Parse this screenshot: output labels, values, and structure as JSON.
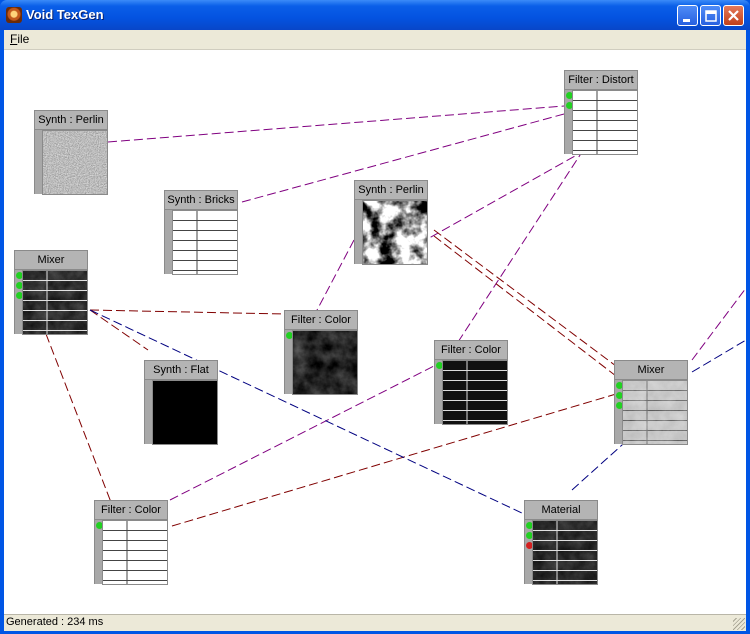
{
  "window": {
    "title": "Void TexGen"
  },
  "menu": {
    "file_label": "File"
  },
  "status": {
    "text": "Generated : 234 ms"
  },
  "nodes": {
    "synth_perlin_1": {
      "title": "Synth : Perlin"
    },
    "synth_bricks": {
      "title": "Synth : Bricks"
    },
    "synth_perlin_2": {
      "title": "Synth : Perlin"
    },
    "filter_distort": {
      "title": "Filter : Distort"
    },
    "mixer_1": {
      "title": "Mixer"
    },
    "filter_color_1": {
      "title": "Filter : Color"
    },
    "synth_flat": {
      "title": "Synth : Flat"
    },
    "filter_color_2": {
      "title": "Filter : Color"
    },
    "mixer_2": {
      "title": "Mixer"
    },
    "filter_color_3": {
      "title": "Filter : Color"
    },
    "material": {
      "title": "Material"
    }
  },
  "colors": {
    "wire_purple": "#800080",
    "wire_brown": "#800000",
    "wire_navy": "#000080",
    "port_active": "#22d022",
    "port_error": "#d42020"
  }
}
